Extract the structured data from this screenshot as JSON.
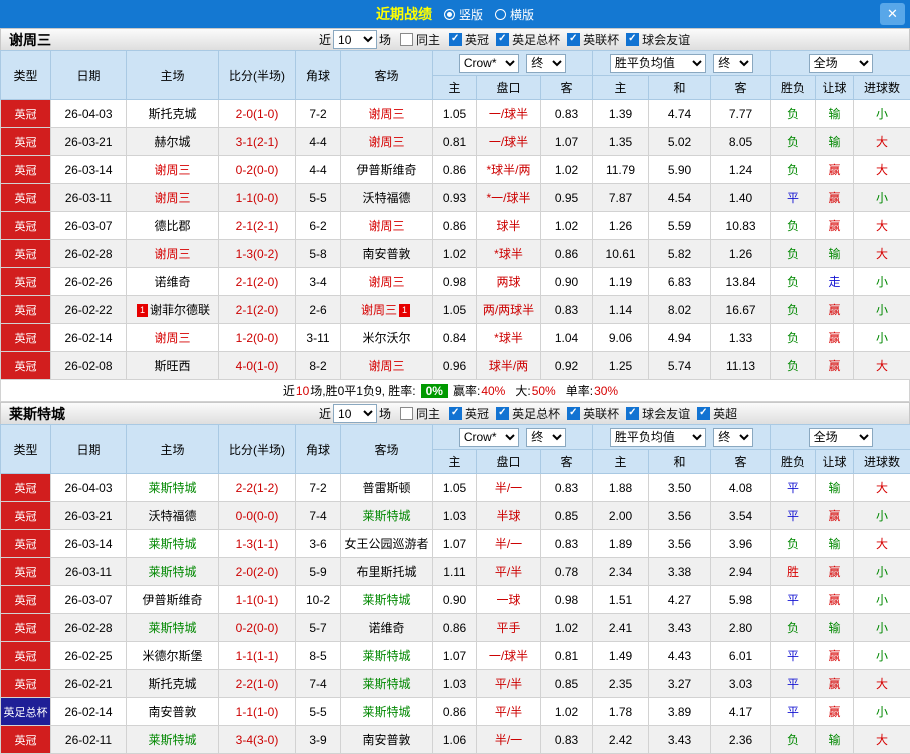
{
  "titlebar": {
    "title": "近期战绩",
    "vertical_label": "竖版",
    "horizontal_label": "横版"
  },
  "icons": {
    "close": "✕"
  },
  "filter_bar": {
    "near_label": "近",
    "count_value": "10",
    "games_label": "场",
    "same_home_label": "同主"
  },
  "table_header": {
    "type": "类型",
    "date": "日期",
    "home": "主场",
    "score": "比分(半场)",
    "corner": "角球",
    "away": "客场",
    "bookmaker_select": "Crow*",
    "final_select_1": "终",
    "avg_select": "胜平负均值",
    "final_select_2": "终",
    "scope_select": "全场",
    "odds_home": "主",
    "odds_handicap": "盘口",
    "odds_away": "客",
    "avg_home": "主",
    "avg_draw": "和",
    "avg_away": "客",
    "result_wdl": "胜负",
    "result_handicap": "让球",
    "result_goals": "进球数"
  },
  "colors": {
    "titlebar_bg": "#1478d2",
    "title_text": "#ffff00",
    "header_bg": "#cde3f5",
    "score_text": "#cc0000",
    "handicap_text": "#cc0000",
    "badge_green": "#009900"
  },
  "type_colors": {
    "英冠": "#d21e1e",
    "英足总杯": "#1f1f96"
  },
  "result_colors": {
    "胜": "#d60000",
    "平": "#1414d2",
    "负": "#008800",
    "赢": "#d60000",
    "走": "#1414d2",
    "输": "#008800",
    "大": "#d60000",
    "小": "#008800"
  },
  "sections": [
    {
      "team": "谢周三",
      "team_color": "#d60000",
      "leagues": [
        {
          "label": "英冠",
          "checked": true
        },
        {
          "label": "英足总杯",
          "checked": true
        },
        {
          "label": "英联杯",
          "checked": true
        },
        {
          "label": "球会友谊",
          "checked": true
        }
      ],
      "rows": [
        {
          "type": "英冠",
          "date": "26-04-03",
          "home": "斯托克城",
          "score": "2-0(1-0)",
          "corner": "7-2",
          "away": "谢周三",
          "away_focus": true,
          "odds_home": "1.05",
          "handicap": "一/球半",
          "odds_away": "0.83",
          "avg_home": "1.39",
          "avg_draw": "4.74",
          "avg_away": "7.77",
          "wdl": "负",
          "let": "输",
          "goals": "小"
        },
        {
          "type": "英冠",
          "date": "26-03-21",
          "home": "赫尔城",
          "score": "3-1(2-1)",
          "corner": "4-4",
          "away": "谢周三",
          "away_focus": true,
          "odds_home": "0.81",
          "handicap": "一/球半",
          "odds_away": "1.07",
          "avg_home": "1.35",
          "avg_draw": "5.02",
          "avg_away": "8.05",
          "wdl": "负",
          "let": "输",
          "goals": "大"
        },
        {
          "type": "英冠",
          "date": "26-03-14",
          "home": "谢周三",
          "home_focus": true,
          "score": "0-2(0-0)",
          "corner": "4-4",
          "away": "伊普斯维奇",
          "odds_home": "0.86",
          "handicap": "*球半/两",
          "odds_away": "1.02",
          "avg_home": "11.79",
          "avg_draw": "5.90",
          "avg_away": "1.24",
          "wdl": "负",
          "let": "赢",
          "goals": "大"
        },
        {
          "type": "英冠",
          "date": "26-03-11",
          "home": "谢周三",
          "home_focus": true,
          "score": "1-1(0-0)",
          "corner": "5-5",
          "away": "沃特福德",
          "odds_home": "0.93",
          "handicap": "*一/球半",
          "odds_away": "0.95",
          "avg_home": "7.87",
          "avg_draw": "4.54",
          "avg_away": "1.40",
          "wdl": "平",
          "let": "赢",
          "goals": "小"
        },
        {
          "type": "英冠",
          "date": "26-03-07",
          "home": "德比郡",
          "score": "2-1(2-1)",
          "corner": "6-2",
          "away": "谢周三",
          "away_focus": true,
          "odds_home": "0.86",
          "handicap": "球半",
          "odds_away": "1.02",
          "avg_home": "1.26",
          "avg_draw": "5.59",
          "avg_away": "10.83",
          "wdl": "负",
          "let": "赢",
          "goals": "大"
        },
        {
          "type": "英冠",
          "date": "26-02-28",
          "home": "谢周三",
          "home_focus": true,
          "score": "1-3(0-2)",
          "corner": "5-8",
          "away": "南安普敦",
          "odds_home": "1.02",
          "handicap": "*球半",
          "odds_away": "0.86",
          "avg_home": "10.61",
          "avg_draw": "5.82",
          "avg_away": "1.26",
          "wdl": "负",
          "let": "输",
          "goals": "大"
        },
        {
          "type": "英冠",
          "date": "26-02-26",
          "home": "诺维奇",
          "score": "2-1(2-0)",
          "corner": "3-4",
          "away": "谢周三",
          "away_focus": true,
          "odds_home": "0.98",
          "handicap": "两球",
          "odds_away": "0.90",
          "avg_home": "1.19",
          "avg_draw": "6.83",
          "avg_away": "13.84",
          "wdl": "负",
          "let": "走",
          "goals": "小"
        },
        {
          "type": "英冠",
          "date": "26-02-22",
          "home": "谢菲尔德联",
          "home_badge": "1",
          "score": "2-1(2-0)",
          "corner": "2-6",
          "away": "谢周三",
          "away_focus": true,
          "away_badge": "1",
          "odds_home": "1.05",
          "handicap": "两/两球半",
          "odds_away": "0.83",
          "avg_home": "1.14",
          "avg_draw": "8.02",
          "avg_away": "16.67",
          "wdl": "负",
          "let": "赢",
          "goals": "小"
        },
        {
          "type": "英冠",
          "date": "26-02-14",
          "home": "谢周三",
          "home_focus": true,
          "score": "1-2(0-0)",
          "corner": "3-11",
          "away": "米尔沃尔",
          "odds_home": "0.84",
          "handicap": "*球半",
          "odds_away": "1.04",
          "avg_home": "9.06",
          "avg_draw": "4.94",
          "avg_away": "1.33",
          "wdl": "负",
          "let": "赢",
          "goals": "小"
        },
        {
          "type": "英冠",
          "date": "26-02-08",
          "home": "斯旺西",
          "score": "4-0(1-0)",
          "corner": "8-2",
          "away": "谢周三",
          "away_focus": true,
          "odds_home": "0.96",
          "handicap": "球半/两",
          "odds_away": "0.92",
          "avg_home": "1.25",
          "avg_draw": "5.74",
          "avg_away": "11.13",
          "wdl": "负",
          "let": "赢",
          "goals": "大"
        }
      ],
      "summary": {
        "prefix": "近",
        "count": "10",
        "mid": "场,胜0平1负9, 胜率:",
        "win_rate_badge": "0%",
        "stats": [
          {
            "label": "赢率:",
            "value": "40%"
          },
          {
            "label": "大:",
            "value": "50%"
          },
          {
            "label": "单率:",
            "value": "30%"
          }
        ]
      }
    },
    {
      "team": "莱斯特城",
      "team_color": "#008800",
      "leagues": [
        {
          "label": "英冠",
          "checked": true
        },
        {
          "label": "英足总杯",
          "checked": true
        },
        {
          "label": "英联杯",
          "checked": true
        },
        {
          "label": "球会友谊",
          "checked": true
        },
        {
          "label": "英超",
          "checked": true
        }
      ],
      "rows": [
        {
          "type": "英冠",
          "date": "26-04-03",
          "home": "莱斯特城",
          "home_focus": true,
          "score": "2-2(1-2)",
          "corner": "7-2",
          "away": "普雷斯顿",
          "odds_home": "1.05",
          "handicap": "半/一",
          "odds_away": "0.83",
          "avg_home": "1.88",
          "avg_draw": "3.50",
          "avg_away": "4.08",
          "wdl": "平",
          "let": "输",
          "goals": "大"
        },
        {
          "type": "英冠",
          "date": "26-03-21",
          "home": "沃特福德",
          "score": "0-0(0-0)",
          "corner": "7-4",
          "away": "莱斯特城",
          "away_focus": true,
          "odds_home": "1.03",
          "handicap": "半球",
          "odds_away": "0.85",
          "avg_home": "2.00",
          "avg_draw": "3.56",
          "avg_away": "3.54",
          "wdl": "平",
          "let": "赢",
          "goals": "小"
        },
        {
          "type": "英冠",
          "date": "26-03-14",
          "home": "莱斯特城",
          "home_focus": true,
          "score": "1-3(1-1)",
          "corner": "3-6",
          "away": "女王公园巡游者",
          "odds_home": "1.07",
          "handicap": "半/一",
          "odds_away": "0.83",
          "avg_home": "1.89",
          "avg_draw": "3.56",
          "avg_away": "3.96",
          "wdl": "负",
          "let": "输",
          "goals": "大"
        },
        {
          "type": "英冠",
          "date": "26-03-11",
          "home": "莱斯特城",
          "home_focus": true,
          "score": "2-0(2-0)",
          "corner": "5-9",
          "away": "布里斯托城",
          "odds_home": "1.11",
          "handicap": "平/半",
          "odds_away": "0.78",
          "avg_home": "2.34",
          "avg_draw": "3.38",
          "avg_away": "2.94",
          "wdl": "胜",
          "let": "赢",
          "goals": "小"
        },
        {
          "type": "英冠",
          "date": "26-03-07",
          "home": "伊普斯维奇",
          "score": "1-1(0-1)",
          "corner": "10-2",
          "away": "莱斯特城",
          "away_focus": true,
          "odds_home": "0.90",
          "handicap": "一球",
          "odds_away": "0.98",
          "avg_home": "1.51",
          "avg_draw": "4.27",
          "avg_away": "5.98",
          "wdl": "平",
          "let": "赢",
          "goals": "小"
        },
        {
          "type": "英冠",
          "date": "26-02-28",
          "home": "莱斯特城",
          "home_focus": true,
          "score": "0-2(0-0)",
          "corner": "5-7",
          "away": "诺维奇",
          "odds_home": "0.86",
          "handicap": "平手",
          "odds_away": "1.02",
          "avg_home": "2.41",
          "avg_draw": "3.43",
          "avg_away": "2.80",
          "wdl": "负",
          "let": "输",
          "goals": "小"
        },
        {
          "type": "英冠",
          "date": "26-02-25",
          "home": "米德尔斯堡",
          "score": "1-1(1-1)",
          "corner": "8-5",
          "away": "莱斯特城",
          "away_focus": true,
          "odds_home": "1.07",
          "handicap": "一/球半",
          "odds_away": "0.81",
          "avg_home": "1.49",
          "avg_draw": "4.43",
          "avg_away": "6.01",
          "wdl": "平",
          "let": "赢",
          "goals": "小"
        },
        {
          "type": "英冠",
          "date": "26-02-21",
          "home": "斯托克城",
          "score": "2-2(1-0)",
          "corner": "7-4",
          "away": "莱斯特城",
          "away_focus": true,
          "odds_home": "1.03",
          "handicap": "平/半",
          "odds_away": "0.85",
          "avg_home": "2.35",
          "avg_draw": "3.27",
          "avg_away": "3.03",
          "wdl": "平",
          "let": "赢",
          "goals": "大"
        },
        {
          "type": "英足总杯",
          "date": "26-02-14",
          "home": "南安普敦",
          "score": "1-1(1-0)",
          "corner": "5-5",
          "away": "莱斯特城",
          "away_focus": true,
          "odds_home": "0.86",
          "handicap": "平/半",
          "odds_away": "1.02",
          "avg_home": "1.78",
          "avg_draw": "3.89",
          "avg_away": "4.17",
          "wdl": "平",
          "let": "赢",
          "goals": "小"
        },
        {
          "type": "英冠",
          "date": "26-02-11",
          "home": "莱斯特城",
          "home_focus": true,
          "score": "3-4(3-0)",
          "corner": "3-9",
          "away": "南安普敦",
          "odds_home": "1.06",
          "handicap": "半/一",
          "odds_away": "0.83",
          "avg_home": "2.42",
          "avg_draw": "3.43",
          "avg_away": "2.36",
          "wdl": "负",
          "let": "输",
          "goals": "大"
        }
      ],
      "summary": null
    }
  ]
}
